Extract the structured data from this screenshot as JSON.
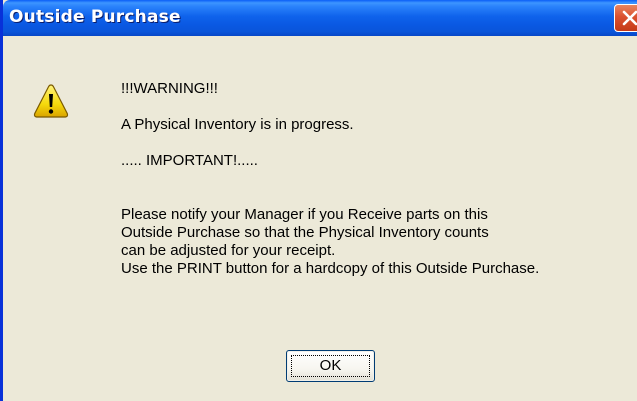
{
  "window": {
    "title": "Outside Purchase",
    "close_icon": "close-icon"
  },
  "icon": {
    "name": "warning-icon",
    "color": "#f5d90b"
  },
  "message": {
    "line1": "!!!WARNING!!!",
    "line2": "A Physical Inventory is in progress.",
    "line3": "..... IMPORTANT!.....",
    "block": [
      "Please notify your Manager if you Receive parts on this",
      "Outside Purchase so that the Physical Inventory counts",
      "can be adjusted for your receipt.",
      "Use the PRINT button for a hardcopy of this Outside Purchase."
    ]
  },
  "buttons": {
    "ok_label": "OK"
  },
  "colors": {
    "titlebar": "#0a58e2",
    "close": "#db5130",
    "dialog_bg": "#ece9d8"
  }
}
